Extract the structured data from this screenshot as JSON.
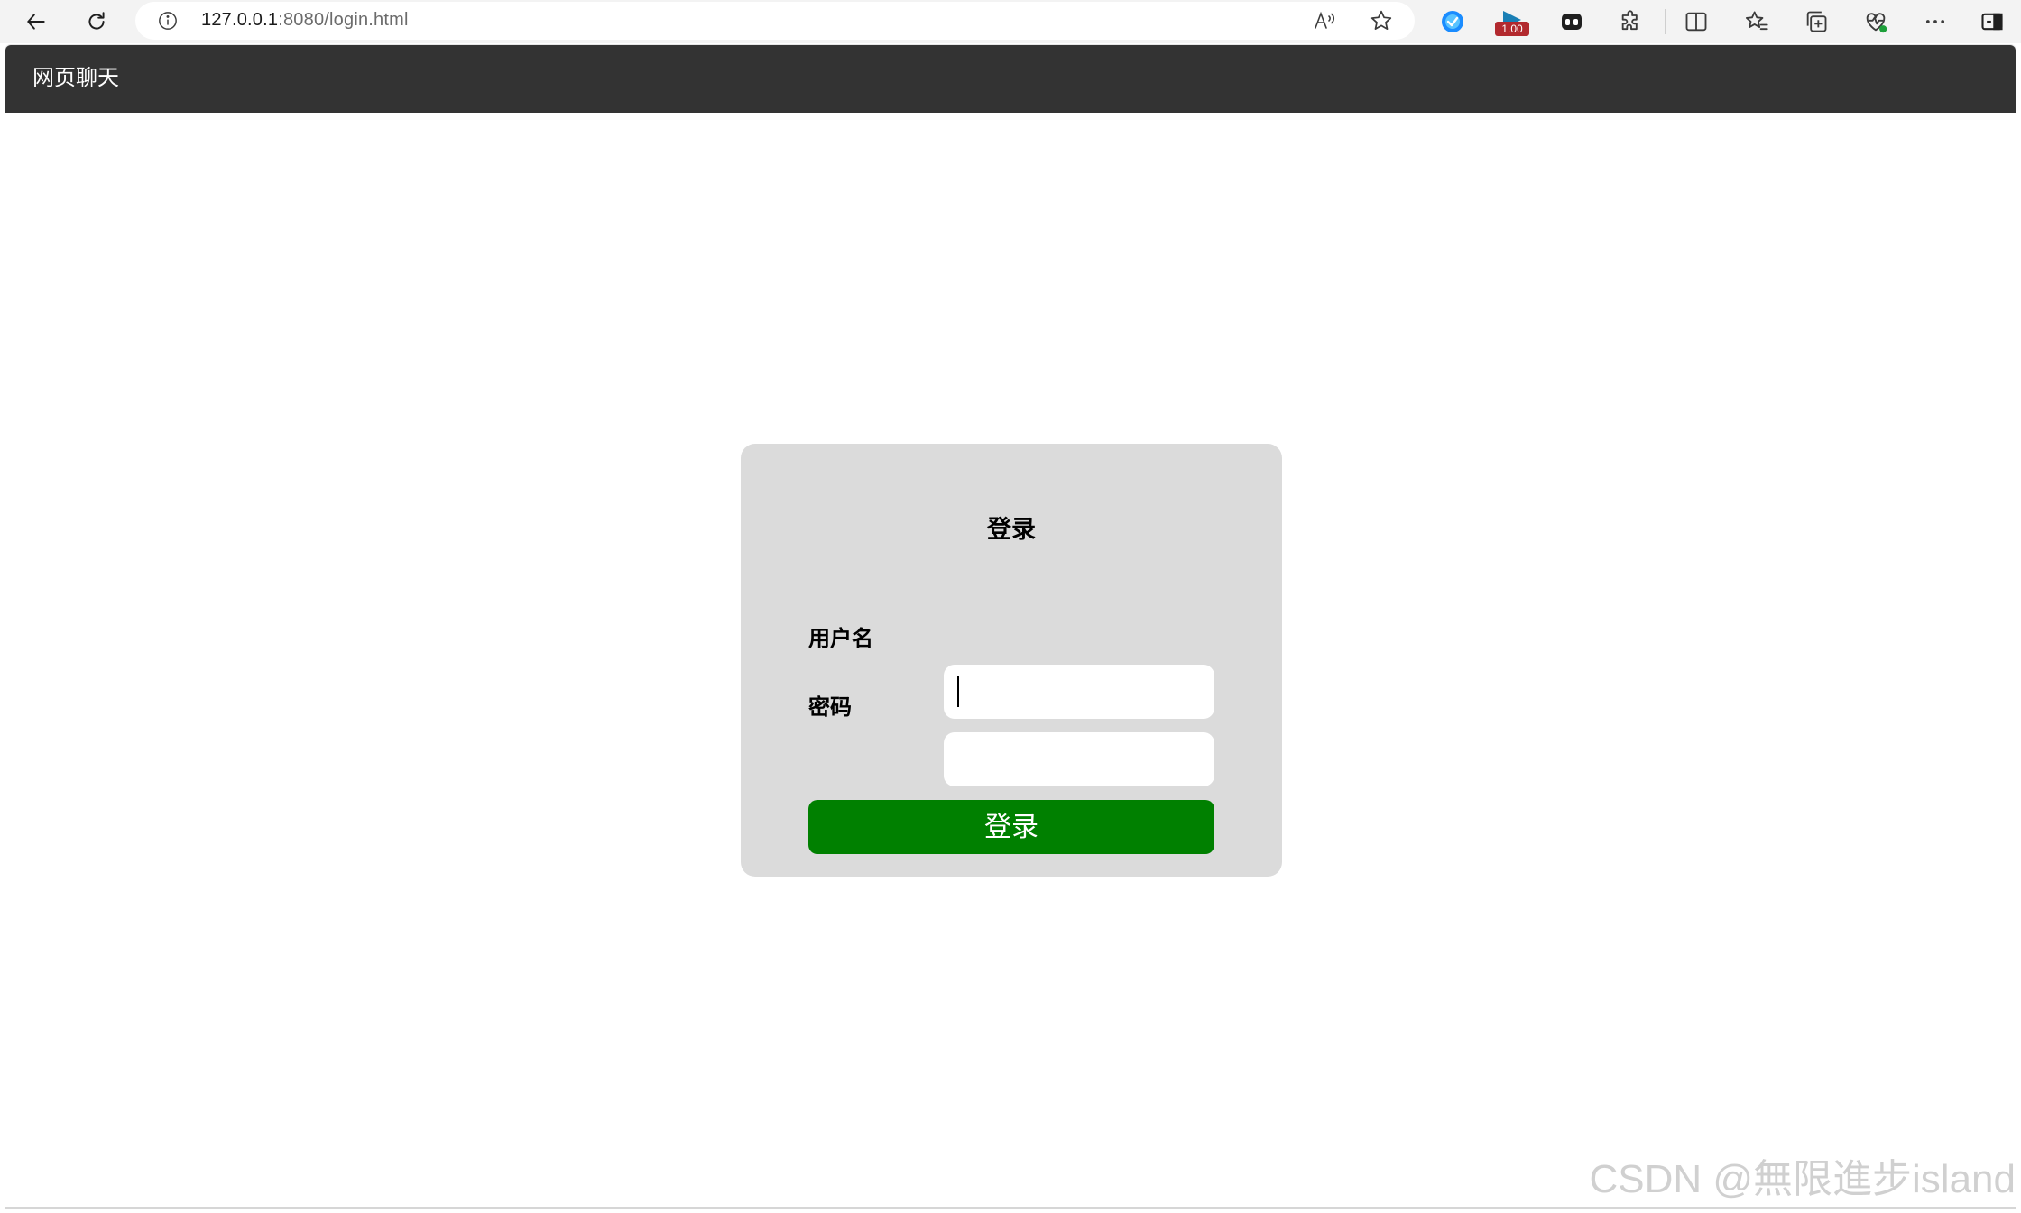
{
  "browser": {
    "url_host": "127.0.0.1",
    "url_path": ":8080/login.html",
    "extension_badge": "1.00",
    "icons": {
      "back": "back-arrow-icon",
      "refresh": "refresh-icon",
      "site_info": "info-icon",
      "read_aloud": "read-aloud-icon",
      "favorite": "star-icon",
      "extension_1": "check-shield-icon",
      "extension_2": "video-speed-icon",
      "extension_3": "copilot-icon",
      "extensions": "puzzle-icon",
      "split_screen": "split-screen-icon",
      "favorites": "favorites-icon",
      "collections": "collections-icon",
      "browser_essentials": "heart-pulse-icon",
      "more": "more-icon",
      "sidebar": "sidebar-icon"
    }
  },
  "app": {
    "title": "网页聊天",
    "header_color": "#333333"
  },
  "login": {
    "title": "登录",
    "username_label": "用户名",
    "username_value": "",
    "password_label": "密码",
    "password_value": "",
    "submit_label": "登录",
    "card_color": "#dbdbdb",
    "button_color": "#008000"
  },
  "watermark": {
    "text": "CSDN @無限進步island"
  }
}
